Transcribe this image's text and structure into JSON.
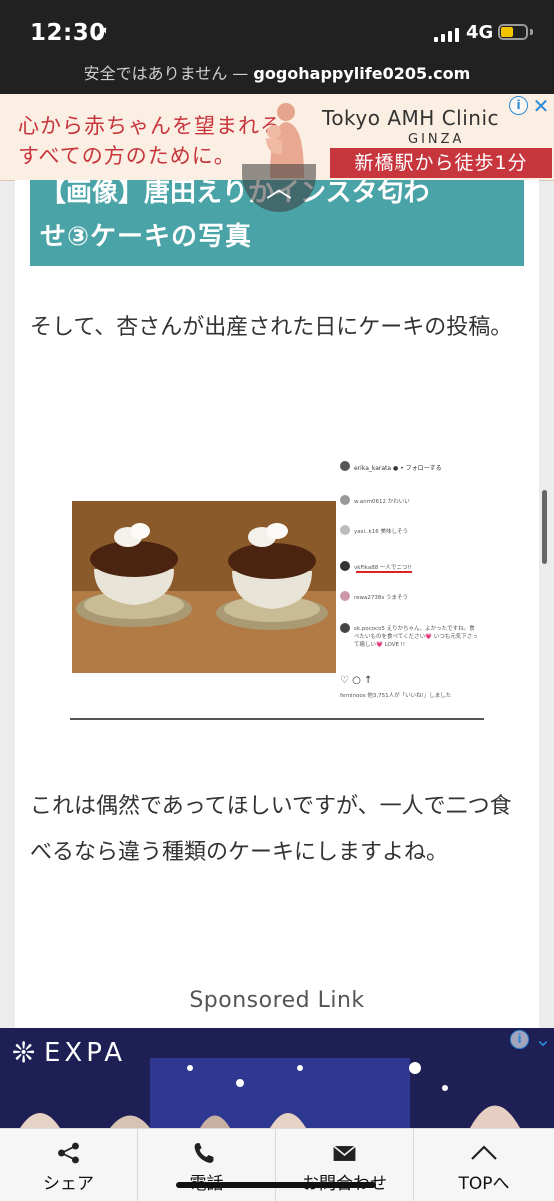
{
  "status_bar": {
    "time": "12:30",
    "network": "4G",
    "security_label": "安全ではありません —",
    "domain": "gogohappylife0205.com"
  },
  "top_ad": {
    "line1": "心から赤ちゃんを望まれる",
    "line2": "すべての方のために。",
    "brand": "Tokyo AMH Clinic",
    "area": "GINZA",
    "cta": "新橋駅から徒歩1分",
    "info_glyph": "i",
    "close_glyph": "✕"
  },
  "article": {
    "heading_line1": "【画像】唐田えりかインスタ匂わ",
    "heading_line2": "せ③ケーキの写真",
    "paragraph1": "そして、杏さんが出産された日にケーキの投稿。",
    "paragraph2": "これは偶然であってほしいですが、一人で二つ食べるなら違う種類のケーキにしますよね。",
    "sponsored": "Sponsored Link"
  },
  "instagram": {
    "username": "erika_karata ● • フォローする",
    "comments": [
      "w.anm0612 かわいい",
      "yasi..k16 美味しそう",
      "vkFika88 一人でニつ!!",
      "rewa2738s うまそう",
      "sk.pococo5 えりかちゃん、よかったですね。食べたいものを食べてください💗 いつも元気下さって嬉しい💗 LOVE !!",
      "ferninoos 他3,751人が「いいね!」しました"
    ],
    "icons": "♡ ○ ↑"
  },
  "bottom_ad": {
    "logo": "EXPA",
    "info_glyph": "i",
    "close_glyph": "⌄"
  },
  "bottom_nav": [
    {
      "label": "シェア",
      "icon": "share-icon"
    },
    {
      "label": "電話",
      "icon": "phone-icon"
    },
    {
      "label": "お問合わせ",
      "icon": "mail-icon"
    },
    {
      "label": "TOPへ",
      "icon": "chevron-up-icon"
    }
  ],
  "colors": {
    "heading_bg": "#4aa3a6",
    "ad_red": "#c8363d",
    "status_bg": "#212121"
  }
}
